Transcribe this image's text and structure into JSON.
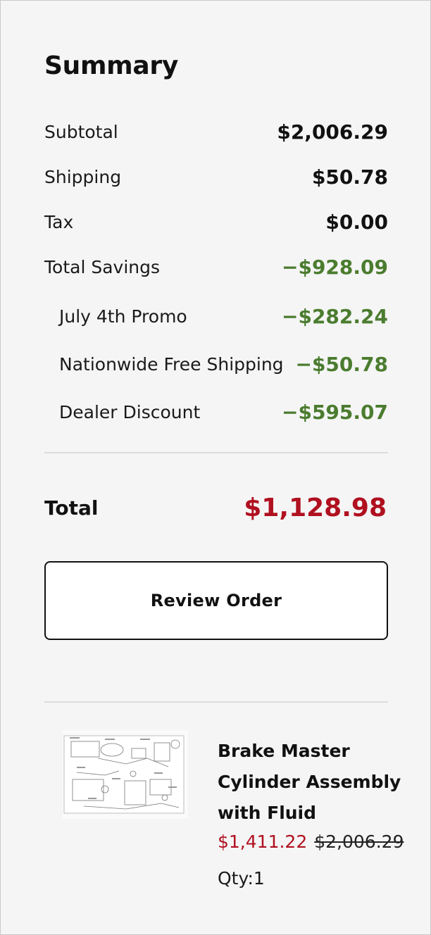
{
  "summary": {
    "title": "Summary",
    "rows": [
      {
        "label": "Subtotal",
        "amount": "$2,006.29"
      },
      {
        "label": "Shipping",
        "amount": "$50.78"
      },
      {
        "label": "Tax",
        "amount": "$0.00"
      },
      {
        "label": "Total Savings",
        "amount": "−$928.09"
      },
      {
        "label": "July 4th Promo",
        "amount": "−$282.24"
      },
      {
        "label": "Nationwide Free Shipping",
        "amount": "−$50.78"
      },
      {
        "label": "Dealer Discount",
        "amount": "−$595.07"
      }
    ],
    "total_label": "Total",
    "total_amount": "$1,128.98",
    "review_button": "Review Order"
  },
  "product": {
    "name": "Brake Master Cylinder Assembly with Fluid",
    "sale_price": "$1,411.22",
    "original_price": "$2,006.29",
    "quantity": "Qty:1",
    "image_icon": "parts-diagram-thumbnail"
  },
  "colors": {
    "savings_green": "#4b7c2f",
    "total_red": "#b0101f",
    "panel_background": "#f5f5f5"
  }
}
